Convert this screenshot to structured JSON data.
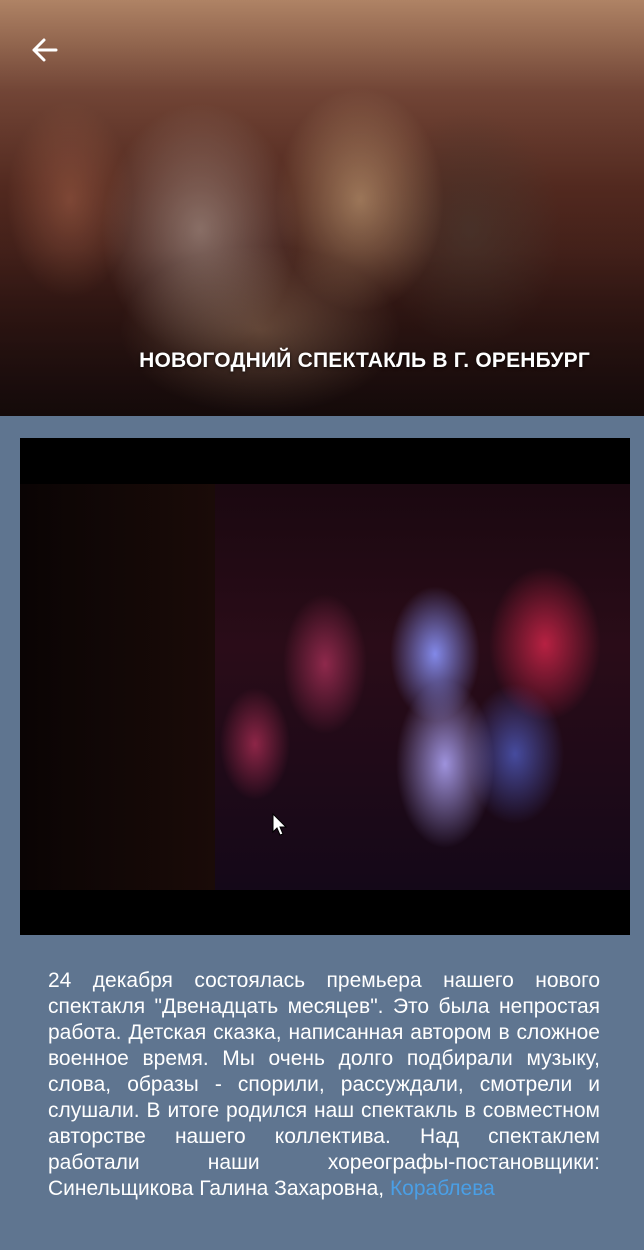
{
  "header": {
    "title": "НОВОГОДНИЙ СПЕКТАКЛЬ В Г. ОРЕНБУРГ",
    "back_icon": "arrow-left-icon"
  },
  "article": {
    "text": "24 декабря состоялась премьера нашего нового спектакля \"Двенадцать месяцев\". Это была непростая работа. Детская сказка, написанная автором в сложное военное время. Мы очень долго подбирали музыку, слова, образы - спорили, рассуждали, смотрели и слушали. В итоге родился наш спектакль в совместном авторстве нашего коллектива. Над спектаклем работали наши хореографы-постановщики: Синельщикова Галина Захаровна, ",
    "link_text": "Кораблева"
  },
  "colors": {
    "background": "#5f7590",
    "link": "#4a9fe6",
    "text": "#ffffff"
  }
}
